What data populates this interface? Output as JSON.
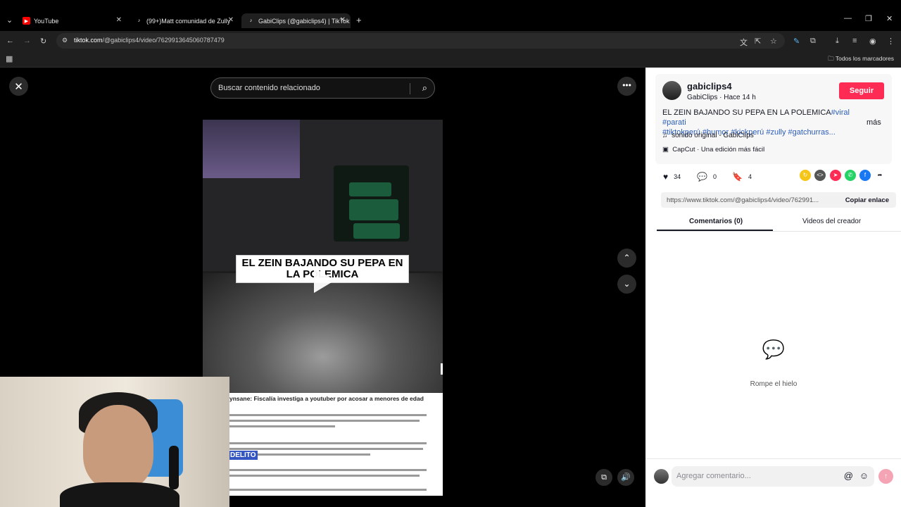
{
  "browser": {
    "tabs": [
      {
        "label": "YouTube",
        "icon": "youtube-icon",
        "color": "#ff0000"
      },
      {
        "label": "(99+)Matt comunidad de Zully",
        "icon": "tiktok-icon",
        "color": "#000000"
      },
      {
        "label": "GabiClips (@gabiclips4) | TikTok",
        "icon": "tiktok-icon",
        "color": "#000000"
      }
    ],
    "url_domain": "tiktok.com",
    "url_path": "/@gabiclips4/video/7629913645060787479",
    "bookmarks_label": "Todos los marcadores"
  },
  "viewer": {
    "search_placeholder": "Buscar contenido relacionado",
    "caption": "EL ZEIN BAJANDO SU PEPA EN LA POLEMICA",
    "article_headline": "ynsane: Fiscalía investiga a youtuber por acosar a menores de edad",
    "article_badge": "DELITO"
  },
  "panel": {
    "username": "gabiclips4",
    "subtitle": "GabiClips · Hace 14 h",
    "follow_label": "Seguir",
    "description_text": "EL ZEIN BAJANDO SU PEPA EN LA POLEMICA",
    "tags_line1": "#viral #parati",
    "tags_line2": "#tiktokperú #humor #kickperú #zully #gatchurras...",
    "more_label": "más",
    "sound": "sonido original - GabiClips",
    "capcut": "CapCut · Una edición más fácil",
    "likes": "34",
    "comments": "0",
    "saves": "4",
    "link": "https://www.tiktok.com/@gabiclips4/video/762991...",
    "copy_label": "Copiar enlace",
    "tab_comments": "Comentarios (0)",
    "tab_videos": "Videos del creador",
    "empty_text": "Rompe el hielo",
    "comment_placeholder": "Agregar comentario...",
    "accent": "#fe2c55"
  }
}
